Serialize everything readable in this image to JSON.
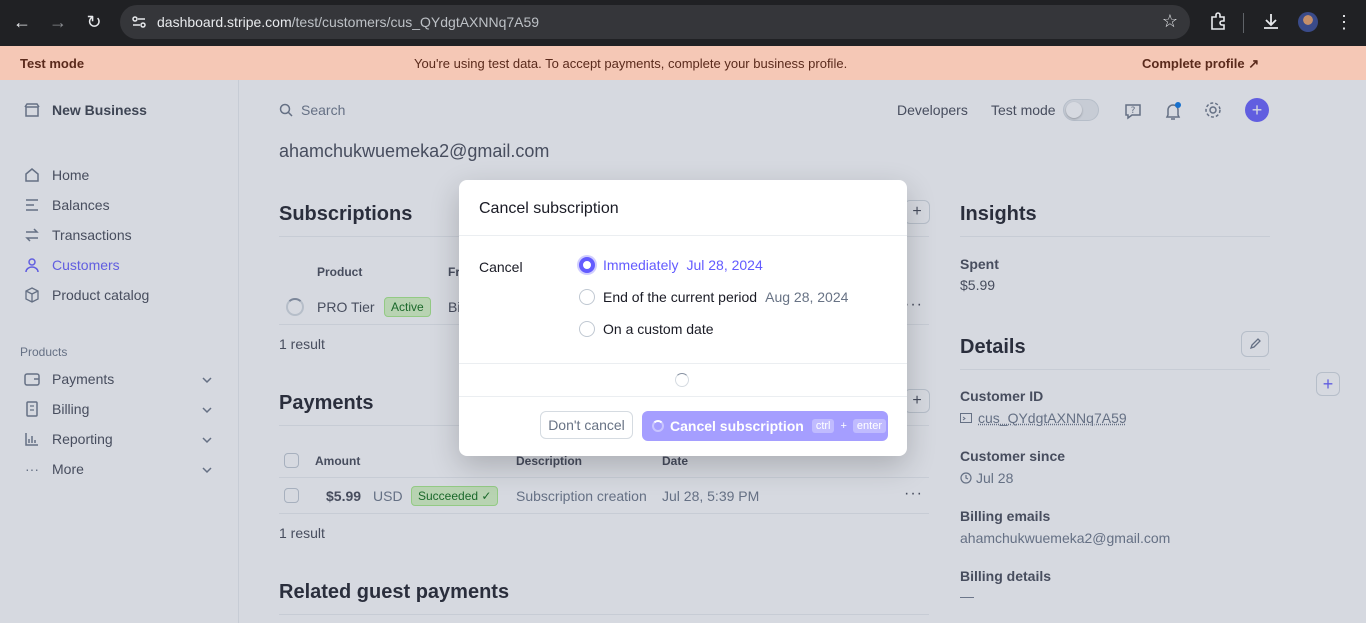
{
  "browser": {
    "url_host": "dashboard.stripe.com",
    "url_path": "/test/customers/cus_QYdgtAXNNq7A59"
  },
  "banner": {
    "left": "Test mode",
    "message": "You're using test data. To accept payments, complete your business profile.",
    "action": "Complete profile"
  },
  "sidebar": {
    "business": "New Business",
    "items": [
      {
        "label": "Home"
      },
      {
        "label": "Balances"
      },
      {
        "label": "Transactions"
      },
      {
        "label": "Customers"
      },
      {
        "label": "Product catalog"
      }
    ],
    "section": "Products",
    "product_items": [
      {
        "label": "Payments"
      },
      {
        "label": "Billing"
      },
      {
        "label": "Reporting"
      },
      {
        "label": "More"
      }
    ]
  },
  "topbar": {
    "search_placeholder": "Search",
    "developers": "Developers",
    "test_mode": "Test mode"
  },
  "customer": {
    "email": "ahamchukwuemeka2@gmail.com"
  },
  "subscriptions": {
    "title": "Subscriptions",
    "columns": [
      "Product",
      "Fr"
    ],
    "row": {
      "product": "PRO Tier",
      "status": "Active",
      "freq": "Bi"
    },
    "result": "1 result"
  },
  "payments": {
    "title": "Payments",
    "columns": [
      "Amount",
      "Description",
      "Date"
    ],
    "row": {
      "amount": "$5.99",
      "currency": "USD",
      "status": "Succeeded",
      "description": "Subscription creation",
      "date": "Jul 28, 5:39 PM"
    },
    "result": "1 result"
  },
  "guest": {
    "title": "Related guest payments"
  },
  "insights": {
    "title": "Insights",
    "spent_label": "Spent",
    "spent_value": "$5.99"
  },
  "details": {
    "title": "Details",
    "customer_id_label": "Customer ID",
    "customer_id": "cus_QYdgtAXNNq7A59",
    "since_label": "Customer since",
    "since": "Jul 28",
    "billing_emails_label": "Billing emails",
    "billing_email": "ahamchukwuemeka2@gmail.com",
    "billing_details_label": "Billing details",
    "billing_details": "—"
  },
  "modal": {
    "title": "Cancel subscription",
    "label": "Cancel",
    "options": [
      {
        "name": "Immediately",
        "date": "Jul 28, 2024",
        "selected": true
      },
      {
        "name": "End of the current period",
        "date": "Aug 28, 2024",
        "selected": false
      },
      {
        "name": "On a custom date",
        "date": "",
        "selected": false
      }
    ],
    "dont_cancel": "Don't cancel",
    "confirm": "Cancel subscription",
    "kbd1": "ctrl",
    "kbd_plus": "+",
    "kbd2": "enter"
  },
  "colors": {
    "accent": "#635bff",
    "banner": "#f5c8b6",
    "success": "#d7f7c2"
  }
}
